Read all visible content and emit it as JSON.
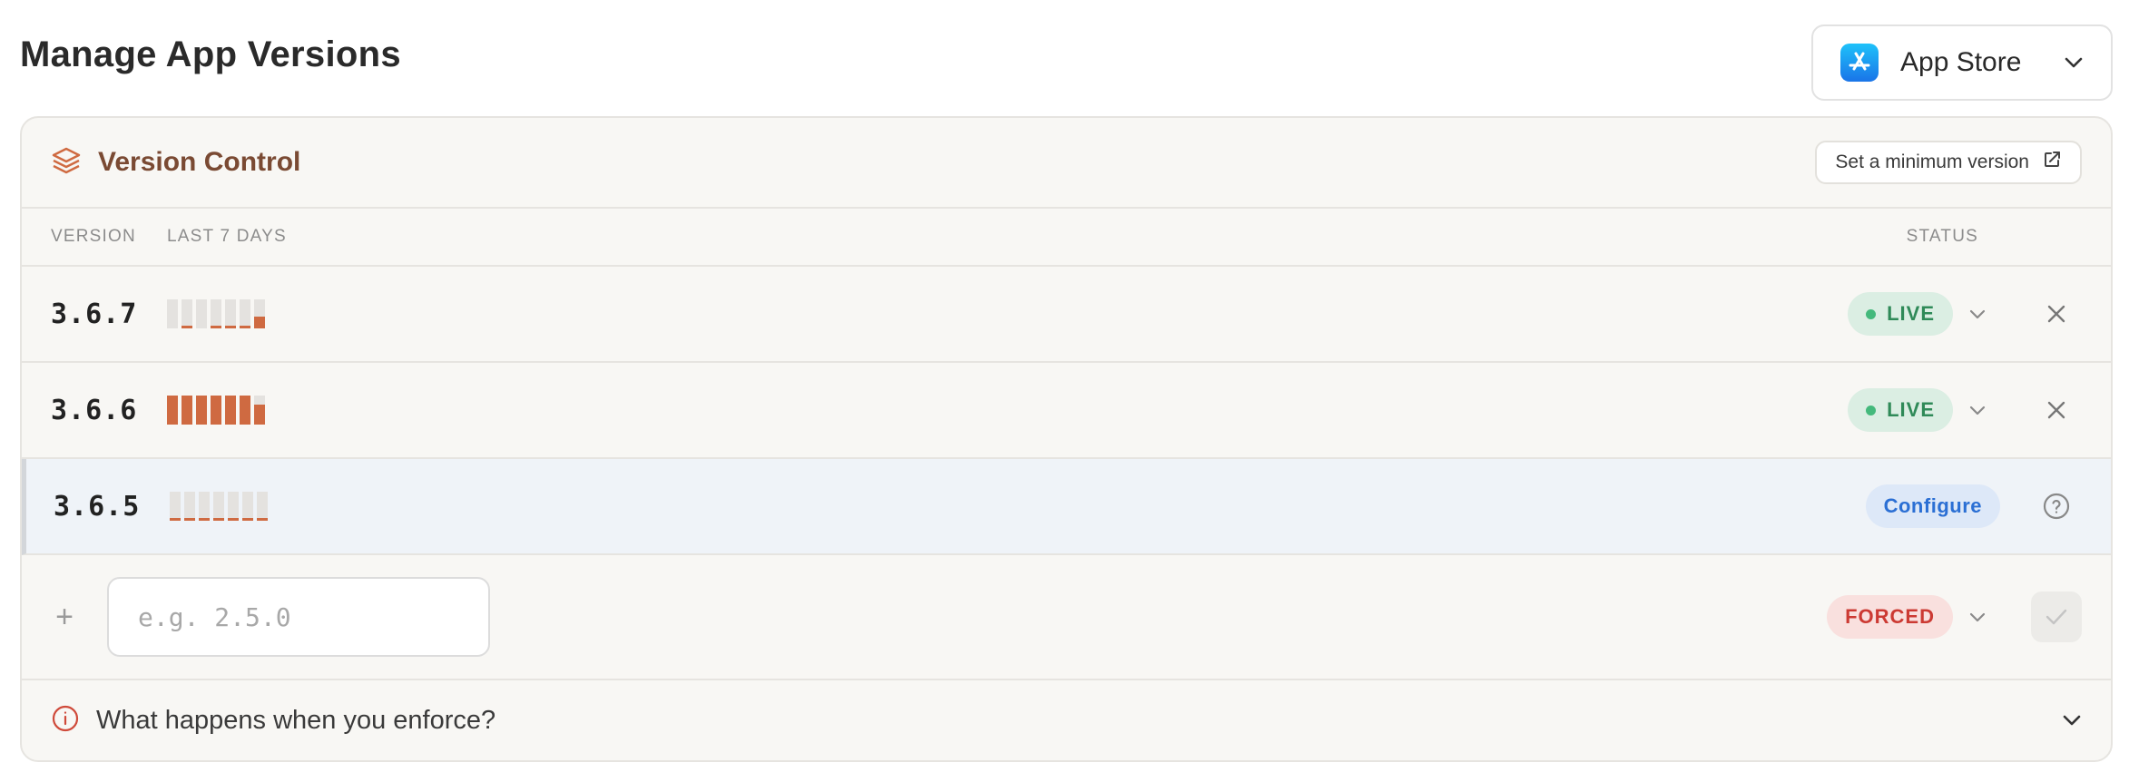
{
  "page": {
    "title": "Manage App Versions"
  },
  "store_select": {
    "selected": "App Store",
    "icon": "app-store-icon"
  },
  "card": {
    "title": "Version Control",
    "min_version_button": "Set a minimum version",
    "columns": {
      "version": "VERSION",
      "last7": "LAST 7 DAYS",
      "status": "STATUS"
    }
  },
  "versions": [
    {
      "version": "3.6.7",
      "usage_last7": [
        0,
        0.1,
        0,
        0.1,
        0.1,
        0.1,
        0.4
      ],
      "status": "LIVE",
      "action": "remove"
    },
    {
      "version": "3.6.6",
      "usage_last7": [
        1,
        1,
        1,
        1,
        1,
        1,
        0.7
      ],
      "status": "LIVE",
      "action": "remove"
    },
    {
      "version": "3.6.5",
      "usage_last7": [
        0.1,
        0.1,
        0.1,
        0.1,
        0.1,
        0.1,
        0.1
      ],
      "status": "Configure",
      "action": "help"
    }
  ],
  "add_row": {
    "placeholder": "e.g. 2.5.0",
    "value": "",
    "status": "FORCED"
  },
  "faq": {
    "question": "What happens when you enforce?"
  },
  "colors": {
    "accent": "#cf6a41",
    "live": "#2f8a58",
    "configure": "#2b6fd4",
    "forced": "#cc3a33",
    "title_brown": "#7a4a33"
  }
}
